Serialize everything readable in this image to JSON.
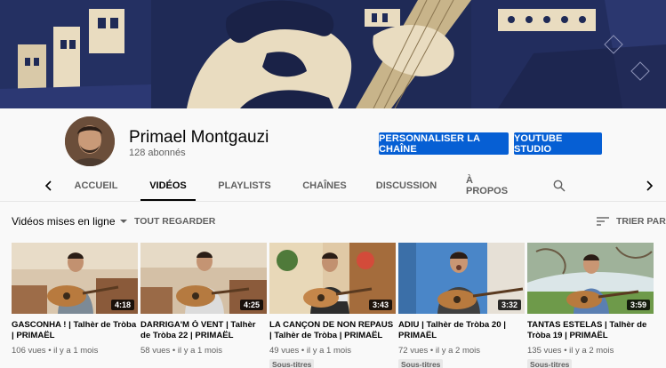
{
  "channel": {
    "name": "Primael Montgauzi",
    "subscribers": "128 abonnés",
    "customize_label": "PERSONNALISER LA CHAÎNE",
    "studio_label": "YOUTUBE STUDIO"
  },
  "tabs": [
    "ACCUEIL",
    "VIDÉOS",
    "PLAYLISTS",
    "CHAÎNES",
    "DISCUSSION",
    "À PROPOS"
  ],
  "active_tab": "VIDÉOS",
  "icons": {
    "search": "search-icon",
    "prev": "chevron-left-icon",
    "next": "chevron-right-icon",
    "sort": "sort-icon"
  },
  "section": {
    "title": "Vidéos mises en ligne",
    "view_all": "TOUT REGARDER",
    "sort_by": "TRIER PAR"
  },
  "videos": [
    {
      "title": "GASCONHA ! | Talhèr de Tròba | PRIMAËL",
      "duration": "4:18",
      "meta": "106 vues • il y a 1 mois",
      "badge": ""
    },
    {
      "title": "DARRIGA'M Ò VENT | Talhèr de Tròba 22 | PRIMAËL",
      "duration": "4:25",
      "meta": "58 vues • il y a 1 mois",
      "badge": ""
    },
    {
      "title": "LA CANÇON DE NON REPAUS | Talhèr de Tròba | PRIMAËL",
      "duration": "3:43",
      "meta": "49 vues • il y a 1 mois",
      "badge": "Sous-titres"
    },
    {
      "title": "ADIU | Talhèr de Tròba 20 | PRIMAËL",
      "duration": "3:32",
      "meta": "72 vues • il y a 2 mois",
      "badge": "Sous-titres"
    },
    {
      "title": "TANTAS ESTELAS | Talhèr de Tròba 19 | PRIMAËL",
      "duration": "3:59",
      "meta": "135 vues • il y a 2 mois",
      "badge": "Sous-titres"
    }
  ],
  "colors": {
    "accent": "#065fd4",
    "banner": "#1f2a56",
    "banner_light": "#e9dcc0"
  }
}
